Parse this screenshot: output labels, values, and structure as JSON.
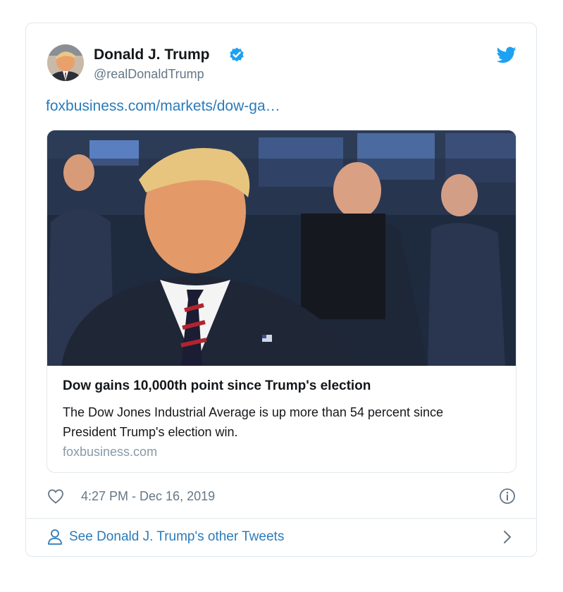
{
  "tweet": {
    "author_name": "Donald J. Trump",
    "handle": "@realDonaldTrump",
    "link_text": "foxbusiness.com/markets/dow-ga…",
    "timestamp": "4:27 PM - Dec 16, 2019"
  },
  "link_card": {
    "title": "Dow gains 10,000th point since Trump's election",
    "description": "The Dow Jones Industrial Average is up more than 54 percent since President Trump's election win.",
    "domain": "foxbusiness.com"
  },
  "footer": {
    "see_more_label": "See Donald J. Trump's other Tweets"
  },
  "icons": {
    "verified": "verified-badge-icon",
    "bird": "twitter-bird-icon",
    "heart": "heart-icon",
    "info": "info-icon",
    "person": "person-icon",
    "chevron": "chevron-right-icon"
  },
  "colors": {
    "accent": "#1da1f2",
    "link": "#2b7bb9",
    "secondary_text": "#657786",
    "border": "#e1e8ed"
  }
}
